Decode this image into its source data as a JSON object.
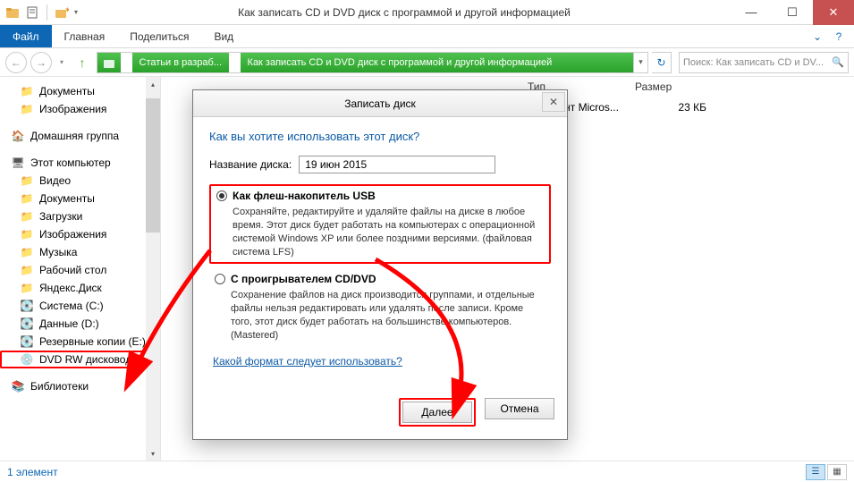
{
  "window": {
    "title": "Как записать CD и DVD диск с программой и другой информацией"
  },
  "ribbon": {
    "file": "Файл",
    "tabs": [
      "Главная",
      "Поделиться",
      "Вид"
    ]
  },
  "nav": {
    "crumb1": "Статьи в разраб...",
    "crumb2": "Как записать CD и DVD диск с программой и другой информацией",
    "search_placeholder": "Поиск: Как записать CD и DV..."
  },
  "tree": {
    "docs": "Документы",
    "pics": "Изображения",
    "home": "Домашняя группа",
    "pc": "Этот компьютер",
    "video": "Видео",
    "docs2": "Документы",
    "downloads": "Загрузки",
    "pics2": "Изображения",
    "music": "Музыка",
    "desktop": "Рабочий стол",
    "yadisk": "Яндекс.Диск",
    "sys": "Система (C:)",
    "data": "Данные (D:)",
    "backup": "Резервные копии (E:)",
    "dvd": "DVD RW дисковод (F:)",
    "libs": "Библиотеки"
  },
  "columns": {
    "type": "Тип",
    "size": "Размер"
  },
  "file": {
    "type": "Документ Micros...",
    "size": "23 КБ"
  },
  "dialog": {
    "title": "Записать диск",
    "heading": "Как вы хотите использовать этот диск?",
    "name_label": "Название диска:",
    "name_value": "19 июн 2015",
    "opt1_title": "Как флеш-накопитель USB",
    "opt1_desc": "Сохраняйте, редактируйте и удаляйте файлы на диске в любое время. Этот диск будет работать на компьютерах с операционной системой Windows XP или более поздними версиями. (файловая система LFS)",
    "opt2_title": "С проигрывателем CD/DVD",
    "opt2_desc": "Сохранение файлов на диск производится группами, и отдельные файлы нельзя редактировать или удалять после записи. Кроме того, этот диск будет работать на большинстве компьютеров. (Mastered)",
    "help_link": "Какой формат следует использовать?",
    "next": "Далее",
    "cancel": "Отмена"
  },
  "status": {
    "count": "1 элемент"
  }
}
